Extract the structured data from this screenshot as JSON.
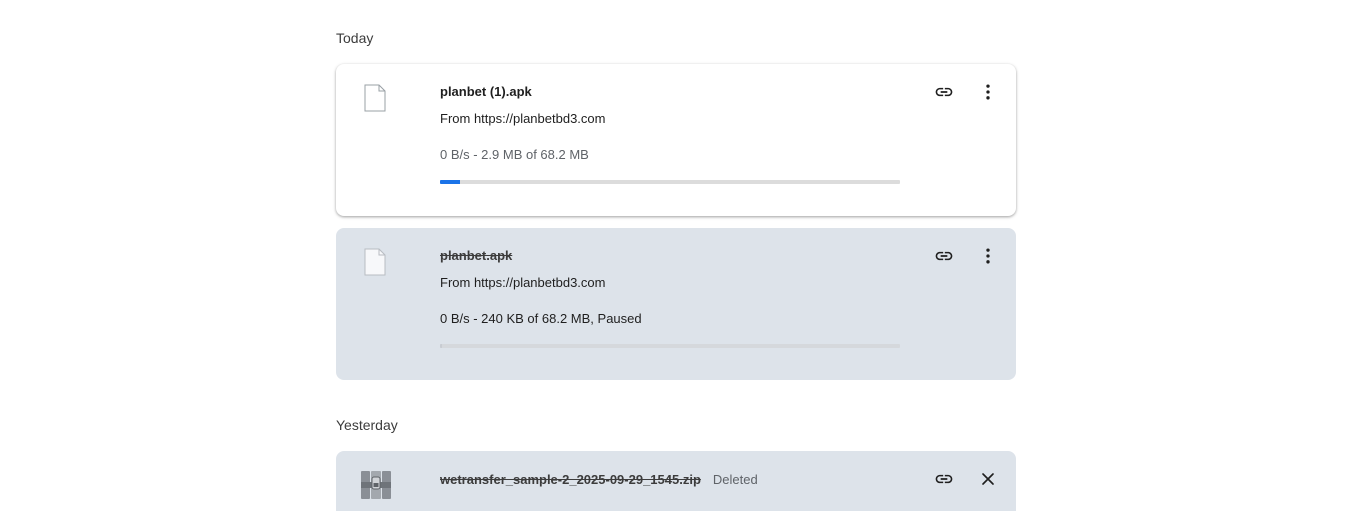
{
  "sections": {
    "today": {
      "heading": "Today"
    },
    "yesterday": {
      "heading": "Yesterday"
    }
  },
  "downloads": [
    {
      "name": "planbet (1).apk",
      "source": "From https://planbetbd3.com",
      "status": "0 B/s - 2.9 MB of 68.2 MB",
      "progress_fraction": 0.0425,
      "state": "in-progress"
    },
    {
      "name": "planbet.apk",
      "source": "From https://planbetbd3.com",
      "status": "0 B/s - 240 KB of 68.2 MB, Paused",
      "progress_fraction": 0.0034,
      "state": "paused"
    },
    {
      "name": "wetransfer_sample-2_2025-09-29_1545.zip",
      "deleted_label": "Deleted",
      "state": "deleted"
    }
  ],
  "icons": {
    "copy_link": "link-icon",
    "more": "more-vert-icon",
    "remove": "close-icon",
    "file": "file-icon",
    "archive": "archive-icon"
  },
  "colors": {
    "accent": "#1a73e8",
    "inactive_card": "#dde3ea",
    "active_card": "#ffffff"
  }
}
